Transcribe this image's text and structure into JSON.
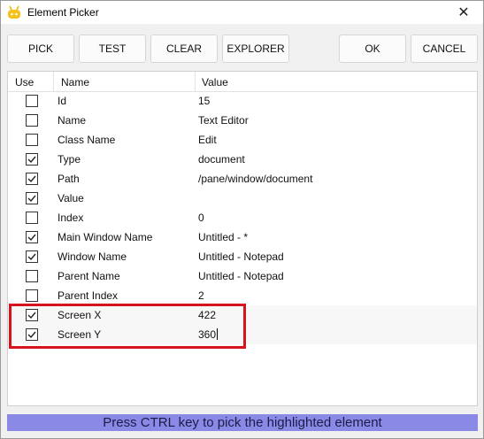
{
  "window": {
    "title": "Element Picker",
    "close_glyph": "✕"
  },
  "toolbar": {
    "pick": "PICK",
    "test": "TEST",
    "clear": "CLEAR",
    "explorer": "EXPLORER",
    "ok": "OK",
    "cancel": "CANCEL"
  },
  "grid": {
    "headers": {
      "use": "Use",
      "name": "Name",
      "value": "Value"
    },
    "rows": [
      {
        "checked": false,
        "name": "Id",
        "value": "15"
      },
      {
        "checked": false,
        "name": "Name",
        "value": "Text Editor"
      },
      {
        "checked": false,
        "name": "Class Name",
        "value": "Edit"
      },
      {
        "checked": true,
        "name": "Type",
        "value": "document"
      },
      {
        "checked": true,
        "name": "Path",
        "value": "/pane/window/document"
      },
      {
        "checked": true,
        "name": "Value",
        "value": ""
      },
      {
        "checked": false,
        "name": "Index",
        "value": "0"
      },
      {
        "checked": true,
        "name": "Main Window Name",
        "value": "Untitled - *"
      },
      {
        "checked": true,
        "name": "Window Name",
        "value": "Untitled - Notepad"
      },
      {
        "checked": false,
        "name": "Parent Name",
        "value": "Untitled - Notepad"
      },
      {
        "checked": false,
        "name": "Parent Index",
        "value": "2"
      },
      {
        "checked": true,
        "name": "Screen X",
        "value": "422"
      },
      {
        "checked": true,
        "name": "Screen Y",
        "value": "360"
      }
    ]
  },
  "status": {
    "text": "Press CTRL key to pick the highlighted element"
  },
  "colors": {
    "highlight": "#d7131d",
    "status_bg": "#8a8ae6"
  }
}
